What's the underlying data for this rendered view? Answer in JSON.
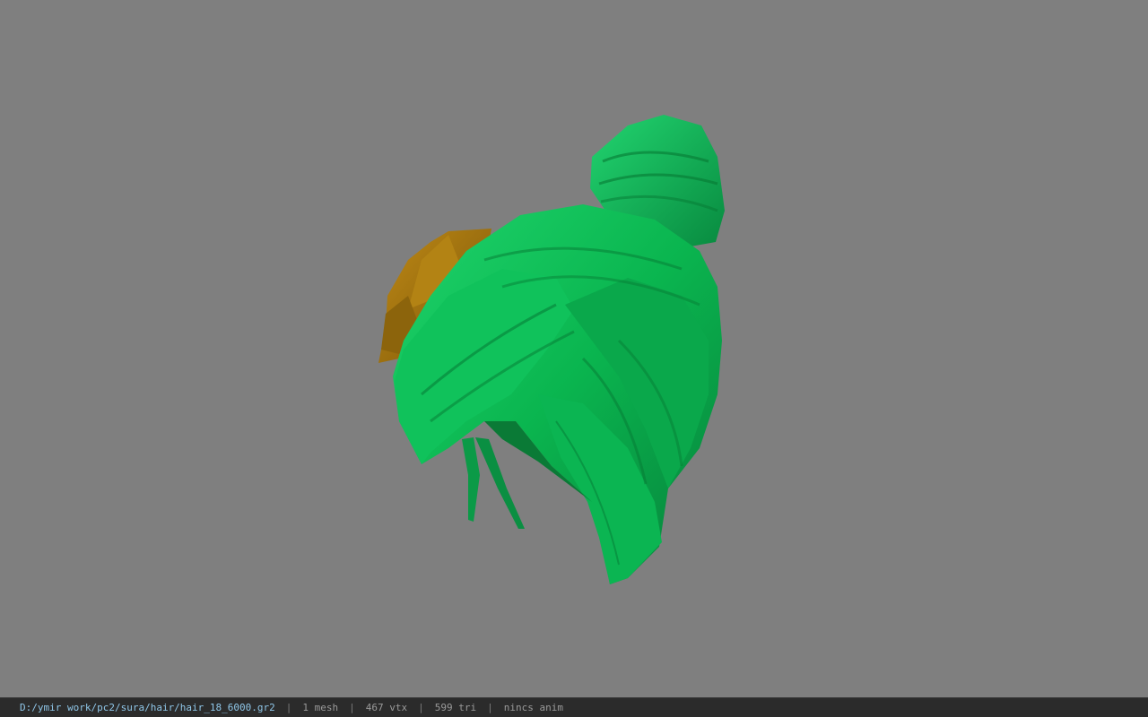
{
  "viewport": {
    "background_color": "#7f7f7f",
    "model": {
      "subject": "green hair bun mesh with golden ornament",
      "hair_color": "#0aa34a",
      "hair_highlight": "#19d068",
      "hair_shadow": "#05702f",
      "ornament_color": "#a67a12"
    }
  },
  "status": {
    "path": "D:/ymir work/pc2/sura/hair/hair_18_6000.gr2",
    "mesh": "1 mesh",
    "vtx": "467 vtx",
    "tri": "599 tri",
    "anim": "nincs anim",
    "separator": "|"
  }
}
